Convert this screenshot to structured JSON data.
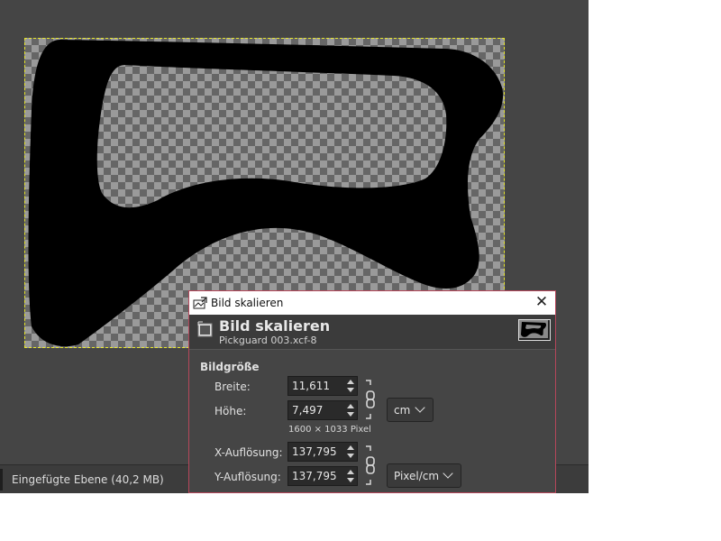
{
  "statusbar": {
    "layer_info": "Eingefügte Ebene (40,2 MB)"
  },
  "dialog": {
    "window_title": "Bild skalieren",
    "header_title": "Bild skalieren",
    "header_subtitle": "Pickguard 003.xcf-8",
    "section_label": "Bildgröße",
    "width_label": "Breite:",
    "width_value": "11,611",
    "height_label": "Höhe:",
    "height_value": "7,497",
    "size_unit": "cm",
    "pixel_size_note": "1600 × 1033 Pixel",
    "xres_label": "X-Auflösung:",
    "xres_value": "137,795",
    "yres_label": "Y-Auflösung:",
    "yres_value": "137,795",
    "res_unit": "Pixel/cm"
  },
  "icons": [
    "scale-image-icon",
    "close-icon",
    "chain-link-icon",
    "chevron-down-icon",
    "image-thumbnail"
  ]
}
